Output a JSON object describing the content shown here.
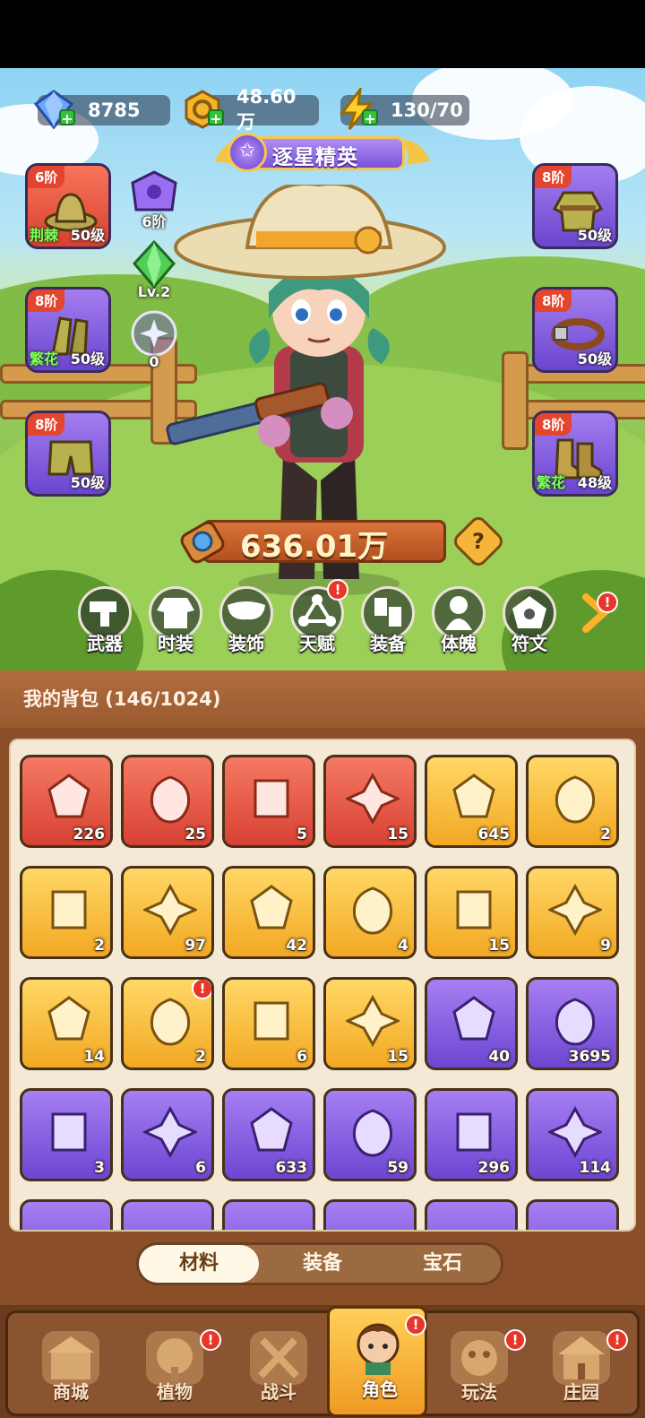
{
  "resources": {
    "gems": "8785",
    "gold": "48.60万",
    "energy": "130/70"
  },
  "player_title": "逐星精英",
  "left_slots": [
    {
      "tier": "6阶",
      "tag": "荆棘",
      "level": "50级",
      "color": "red"
    },
    {
      "tier": "8阶",
      "tag": "繁花",
      "level": "50级",
      "color": "purple"
    },
    {
      "tier": "8阶",
      "tag": "",
      "level": "50级",
      "color": "purple"
    }
  ],
  "right_slots": [
    {
      "tier": "8阶",
      "tag": "",
      "level": "50级",
      "color": "purple"
    },
    {
      "tier": "8阶",
      "tag": "",
      "level": "50级",
      "color": "purple"
    },
    {
      "tier": "8阶",
      "tag": "繁花",
      "level": "48级",
      "color": "purple"
    }
  ],
  "mini_items": {
    "rune": "6阶",
    "crystal": "Lv.2",
    "orb": "0"
  },
  "combat_power": "636.01万",
  "help_label": "?",
  "functions": [
    {
      "label": "武器",
      "icon": "weapon-icon",
      "badge": false
    },
    {
      "label": "时装",
      "icon": "outfit-icon",
      "badge": false
    },
    {
      "label": "装饰",
      "icon": "mask-icon",
      "badge": false
    },
    {
      "label": "天赋",
      "icon": "talent-icon",
      "badge": true
    },
    {
      "label": "装备",
      "icon": "equipment-icon",
      "badge": false
    },
    {
      "label": "体魄",
      "icon": "physique-icon",
      "badge": false
    },
    {
      "label": "符文",
      "icon": "rune-icon",
      "badge": false
    }
  ],
  "bag_title": "我的背包 (146/1024)",
  "bag_items": [
    {
      "color": "red",
      "count": "226",
      "icon": "star-crystal-icon",
      "badge": false
    },
    {
      "color": "red",
      "count": "25",
      "icon": "red-potion-icon",
      "badge": false
    },
    {
      "color": "red",
      "count": "5",
      "icon": "green-tube-icon",
      "badge": false
    },
    {
      "color": "red",
      "count": "15",
      "icon": "knot-badge-icon",
      "badge": false
    },
    {
      "color": "gold",
      "count": "645",
      "icon": "rose-bouquet-icon",
      "badge": false
    },
    {
      "color": "gold",
      "count": "2",
      "icon": "gold-key-icon",
      "badge": false
    },
    {
      "color": "gold",
      "count": "2",
      "icon": "dark-rune-stone-icon",
      "badge": false
    },
    {
      "color": "gold",
      "count": "97",
      "icon": "orange-potion-icon",
      "badge": false
    },
    {
      "color": "gold",
      "count": "42",
      "icon": "gold-pile-icon",
      "badge": false
    },
    {
      "color": "gold",
      "count": "4",
      "icon": "amber-ore-icon",
      "badge": false
    },
    {
      "color": "gold",
      "count": "15",
      "icon": "flower-pot-icon",
      "badge": false
    },
    {
      "color": "gold",
      "count": "9",
      "icon": "sprayer-tank-icon",
      "badge": false
    },
    {
      "color": "gold",
      "count": "14",
      "icon": "spell-book-icon",
      "badge": false
    },
    {
      "color": "gold",
      "count": "2",
      "icon": "telescope-icon",
      "badge": true
    },
    {
      "color": "gold",
      "count": "6",
      "icon": "golden-flower-icon",
      "badge": false
    },
    {
      "color": "gold",
      "count": "15",
      "icon": "knot-badge-icon",
      "badge": false
    },
    {
      "color": "purple",
      "count": "40",
      "icon": "purple-potion-icon",
      "badge": false
    },
    {
      "color": "purple",
      "count": "3695",
      "icon": "lily-flower-icon",
      "badge": false
    },
    {
      "color": "purple",
      "count": "3",
      "icon": "silver-key-icon",
      "badge": false
    },
    {
      "color": "purple",
      "count": "6",
      "icon": "blue-leaf-icon",
      "badge": false
    },
    {
      "color": "purple",
      "count": "633",
      "icon": "seed-scroll-icon",
      "badge": false
    },
    {
      "color": "purple",
      "count": "59",
      "icon": "seed-scroll-icon",
      "badge": false
    },
    {
      "color": "purple",
      "count": "296",
      "icon": "seed-scroll-icon",
      "badge": false
    },
    {
      "color": "purple",
      "count": "114",
      "icon": "seed-scroll-icon",
      "badge": false
    }
  ],
  "bag_tabs": [
    {
      "label": "材料",
      "active": true
    },
    {
      "label": "装备",
      "active": false
    },
    {
      "label": "宝石",
      "active": false
    }
  ],
  "bottom_nav": [
    {
      "label": "商城",
      "icon": "shop-icon",
      "badge": false,
      "active": false
    },
    {
      "label": "植物",
      "icon": "plant-icon",
      "badge": true,
      "active": false
    },
    {
      "label": "战斗",
      "icon": "battle-icon",
      "badge": false,
      "active": false
    },
    {
      "label": "角色",
      "icon": "character-icon",
      "badge": true,
      "active": true
    },
    {
      "label": "玩法",
      "icon": "gameplay-icon",
      "badge": true,
      "active": false
    },
    {
      "label": "庄园",
      "icon": "manor-icon",
      "badge": true,
      "active": false
    }
  ],
  "colors": {
    "slot_red": "#e04a33",
    "slot_gold": "#f2b533",
    "slot_purple": "#7b52dc",
    "badge_red": "#e8372a",
    "bag_brown": "#8a4f28"
  }
}
